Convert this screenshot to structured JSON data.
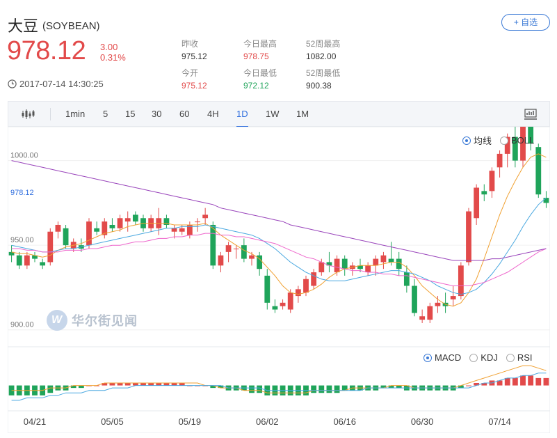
{
  "header": {
    "name": "大豆",
    "code": "(SOYBEAN)",
    "price": "978.12",
    "change": "3.00",
    "change_pct": "0.31%",
    "timestamp": "2017-07-14 14:30:25",
    "watch_label": "+ 自选"
  },
  "stats": [
    {
      "label": "昨收",
      "value": "975.12",
      "tone": "neutral"
    },
    {
      "label": "今日最高",
      "value": "978.75",
      "tone": "red"
    },
    {
      "label": "52周最高",
      "value": "1082.00",
      "tone": "neutral"
    },
    {
      "label": "今开",
      "value": "975.12",
      "tone": "red"
    },
    {
      "label": "今日最低",
      "value": "972.12",
      "tone": "green"
    },
    {
      "label": "52周最低",
      "value": "900.38",
      "tone": "neutral"
    }
  ],
  "toolbar": {
    "chart_type_icon": "candlestick-icon",
    "periods": [
      "1min",
      "5",
      "15",
      "30",
      "60",
      "4H",
      "1D",
      "1W",
      "1M"
    ],
    "active_period": "1D",
    "right_icon": "indicator-panel-icon"
  },
  "legends": {
    "main": [
      {
        "label": "均线",
        "checked": true
      },
      {
        "label": "BOLL",
        "checked": false
      }
    ],
    "sub": [
      {
        "label": "MACD",
        "checked": true
      },
      {
        "label": "KDJ",
        "checked": false
      },
      {
        "label": "RSI",
        "checked": false
      }
    ]
  },
  "watermark": "华尔街见闻",
  "colors": {
    "up": "#e24a4a",
    "down": "#1fa45a",
    "accent": "#2f6ede"
  },
  "chart_data": {
    "type": "candlestick",
    "y_ticks": [
      {
        "value": 1000,
        "label": "1000.00"
      },
      {
        "value": 978.12,
        "label": "978.12",
        "highlight": true
      },
      {
        "value": 950,
        "label": "950.00"
      },
      {
        "value": 900,
        "label": "900.00"
      }
    ],
    "x_ticks": [
      {
        "index": 3,
        "label": "04/21"
      },
      {
        "index": 13,
        "label": "05/05"
      },
      {
        "index": 23,
        "label": "05/19"
      },
      {
        "index": 33,
        "label": "06/02"
      },
      {
        "index": 43,
        "label": "06/16"
      },
      {
        "index": 53,
        "label": "06/30"
      },
      {
        "index": 63,
        "label": "07/14"
      }
    ],
    "ylim": [
      890,
      1020
    ],
    "candles": [
      [
        946,
        950,
        940,
        944
      ],
      [
        944,
        946,
        936,
        938
      ],
      [
        938,
        946,
        936,
        944
      ],
      [
        944,
        946,
        940,
        942
      ],
      [
        940,
        942,
        936,
        938
      ],
      [
        940,
        960,
        938,
        958
      ],
      [
        958,
        964,
        954,
        962
      ],
      [
        960,
        962,
        948,
        950
      ],
      [
        948,
        954,
        946,
        952
      ],
      [
        950,
        954,
        946,
        948
      ],
      [
        950,
        966,
        948,
        964
      ],
      [
        960,
        964,
        956,
        958
      ],
      [
        956,
        966,
        954,
        964
      ],
      [
        962,
        966,
        958,
        960
      ],
      [
        960,
        968,
        958,
        966
      ],
      [
        964,
        970,
        958,
        966
      ],
      [
        968,
        970,
        962,
        964
      ],
      [
        966,
        968,
        958,
        960
      ],
      [
        960,
        968,
        958,
        966
      ],
      [
        960,
        972,
        956,
        966
      ],
      [
        966,
        968,
        960,
        962
      ],
      [
        958,
        962,
        954,
        960
      ],
      [
        958,
        962,
        956,
        960
      ],
      [
        956,
        964,
        954,
        962
      ],
      [
        964,
        966,
        958,
        964
      ],
      [
        966,
        972,
        962,
        968
      ],
      [
        962,
        964,
        936,
        938
      ],
      [
        938,
        946,
        934,
        944
      ],
      [
        946,
        952,
        940,
        950
      ],
      [
        948,
        950,
        942,
        948
      ],
      [
        950,
        954,
        940,
        942
      ],
      [
        942,
        946,
        938,
        944
      ],
      [
        944,
        946,
        932,
        936
      ],
      [
        932,
        936,
        912,
        916
      ],
      [
        914,
        918,
        910,
        912
      ],
      [
        914,
        918,
        912,
        916
      ],
      [
        912,
        924,
        910,
        922
      ],
      [
        920,
        926,
        916,
        924
      ],
      [
        922,
        932,
        920,
        930
      ],
      [
        926,
        936,
        924,
        934
      ],
      [
        934,
        942,
        932,
        940
      ],
      [
        940,
        946,
        934,
        938
      ],
      [
        934,
        944,
        932,
        942
      ],
      [
        942,
        944,
        932,
        936
      ],
      [
        936,
        940,
        932,
        938
      ],
      [
        938,
        942,
        934,
        936
      ],
      [
        934,
        940,
        932,
        938
      ],
      [
        938,
        944,
        932,
        942
      ],
      [
        940,
        946,
        936,
        944
      ],
      [
        942,
        952,
        938,
        940
      ],
      [
        942,
        946,
        932,
        936
      ],
      [
        934,
        938,
        922,
        926
      ],
      [
        926,
        930,
        908,
        910
      ],
      [
        906,
        912,
        904,
        908
      ],
      [
        906,
        916,
        904,
        914
      ],
      [
        914,
        920,
        910,
        916
      ],
      [
        916,
        922,
        910,
        914
      ],
      [
        918,
        926,
        914,
        920
      ],
      [
        920,
        940,
        918,
        938
      ],
      [
        940,
        972,
        938,
        970
      ],
      [
        966,
        986,
        962,
        984
      ],
      [
        982,
        986,
        976,
        980
      ],
      [
        982,
        996,
        978,
        994
      ],
      [
        996,
        1006,
        990,
        1004
      ],
      [
        1004,
        1016,
        996,
        1014
      ],
      [
        1014,
        1020,
        996,
        1000
      ],
      [
        1000,
        1024,
        996,
        1020
      ],
      [
        1020,
        1026,
        1006,
        1010
      ],
      [
        1008,
        1010,
        978,
        980
      ],
      [
        978,
        982,
        972,
        975
      ]
    ],
    "ma_series": [
      {
        "color": "#f0a030",
        "values": [
          946,
          945,
          945,
          944,
          943,
          944,
          947,
          949,
          950,
          951,
          953,
          955,
          957,
          958,
          959,
          961,
          962,
          963,
          963,
          963,
          963,
          962,
          962,
          962,
          962,
          963,
          960,
          956,
          953,
          950,
          947,
          945,
          942,
          937,
          932,
          926,
          922,
          921,
          922,
          924,
          927,
          931,
          934,
          936,
          937,
          938,
          938,
          938,
          939,
          940,
          940,
          937,
          932,
          926,
          922,
          918,
          915,
          914,
          916,
          922,
          930,
          942,
          955,
          968,
          979,
          988,
          996,
          1002,
          1004,
          1002
        ]
      },
      {
        "color": "#4aa8e0",
        "values": [
          950,
          949,
          948,
          947,
          946,
          946,
          947,
          948,
          948,
          949,
          950,
          951,
          952,
          953,
          954,
          955,
          956,
          957,
          958,
          959,
          960,
          960,
          961,
          961,
          961,
          962,
          961,
          960,
          959,
          958,
          957,
          956,
          954,
          951,
          948,
          944,
          940,
          937,
          934,
          932,
          930,
          929,
          929,
          929,
          930,
          931,
          932,
          933,
          934,
          935,
          935,
          934,
          933,
          931,
          929,
          926,
          924,
          922,
          921,
          922,
          924,
          928,
          933,
          939,
          946,
          953,
          961,
          968,
          974,
          978
        ]
      },
      {
        "color": "#ee66cc",
        "values": [
          948,
          948,
          947,
          947,
          946,
          946,
          946,
          947,
          947,
          947,
          948,
          948,
          949,
          950,
          950,
          951,
          952,
          952,
          953,
          954,
          954,
          955,
          955,
          956,
          956,
          957,
          957,
          956,
          956,
          955,
          955,
          954,
          953,
          952,
          951,
          949,
          947,
          945,
          943,
          942,
          940,
          938,
          937,
          936,
          935,
          935,
          934,
          934,
          933,
          933,
          932,
          932,
          931,
          930,
          929,
          928,
          927,
          926,
          926,
          926,
          927,
          928,
          930,
          932,
          934,
          937,
          940,
          943,
          946,
          948
        ]
      },
      {
        "color": "#9944bb",
        "values": [
          1000,
          999,
          998,
          997,
          996,
          995,
          994,
          993,
          992,
          991,
          990,
          989,
          988,
          987,
          986,
          985,
          984,
          983,
          982,
          981,
          980,
          979,
          978,
          977,
          976,
          975,
          974,
          972,
          971,
          970,
          969,
          968,
          967,
          966,
          965,
          964,
          962,
          961,
          960,
          959,
          958,
          957,
          956,
          955,
          954,
          953,
          952,
          951,
          950,
          949,
          948,
          947,
          946,
          945,
          944,
          943,
          942,
          941,
          941,
          941,
          941,
          941,
          942,
          942,
          943,
          944,
          945,
          946,
          947,
          948
        ]
      }
    ],
    "macd": {
      "histogram": [
        -4,
        -4,
        -4,
        -4,
        -4,
        -3,
        -2,
        -2,
        -1,
        -1,
        0,
        0,
        1,
        1,
        1,
        1,
        1,
        1,
        1,
        1,
        1,
        1,
        1,
        0,
        0,
        0,
        -1,
        -1,
        -2,
        -2,
        -2,
        -3,
        -3,
        -4,
        -4,
        -4,
        -4,
        -4,
        -4,
        -3,
        -3,
        -3,
        -3,
        -2,
        -2,
        -2,
        -2,
        -2,
        -1,
        -1,
        -1,
        -2,
        -2,
        -2,
        -2,
        -2,
        -2,
        -2,
        -1,
        0,
        1,
        1,
        2,
        2,
        3,
        3,
        4,
        4,
        3,
        3
      ],
      "dif": [
        -2,
        -2,
        -2,
        -2,
        -2,
        -1,
        -1,
        -1,
        0,
        0,
        0,
        0,
        1,
        1,
        1,
        1,
        1,
        1,
        1,
        1,
        1,
        1,
        1,
        1,
        1,
        0,
        0,
        -1,
        -1,
        -1,
        -2,
        -2,
        -2,
        -3,
        -3,
        -3,
        -3,
        -3,
        -3,
        -2,
        -2,
        -2,
        -2,
        -2,
        -1,
        -1,
        -1,
        -1,
        -1,
        0,
        0,
        0,
        -1,
        -1,
        -1,
        -1,
        -1,
        -1,
        0,
        1,
        2,
        3,
        4,
        5,
        6,
        7,
        8,
        8,
        7,
        6
      ],
      "dea": [
        -6,
        -6,
        -5,
        -5,
        -5,
        -4,
        -4,
        -3,
        -3,
        -3,
        -2,
        -2,
        -2,
        -1,
        -1,
        -1,
        0,
        0,
        0,
        0,
        0,
        0,
        0,
        0,
        0,
        0,
        0,
        0,
        -1,
        -1,
        -1,
        -1,
        -1,
        -2,
        -2,
        -2,
        -2,
        -2,
        -2,
        -2,
        -2,
        -2,
        -2,
        -2,
        -2,
        -2,
        -1,
        -1,
        -1,
        -1,
        -1,
        -1,
        -1,
        -1,
        -1,
        -1,
        -1,
        -1,
        -1,
        -1,
        0,
        1,
        1,
        2,
        3,
        3,
        4,
        4,
        5,
        5
      ],
      "ylim": [
        -8,
        10
      ]
    }
  }
}
